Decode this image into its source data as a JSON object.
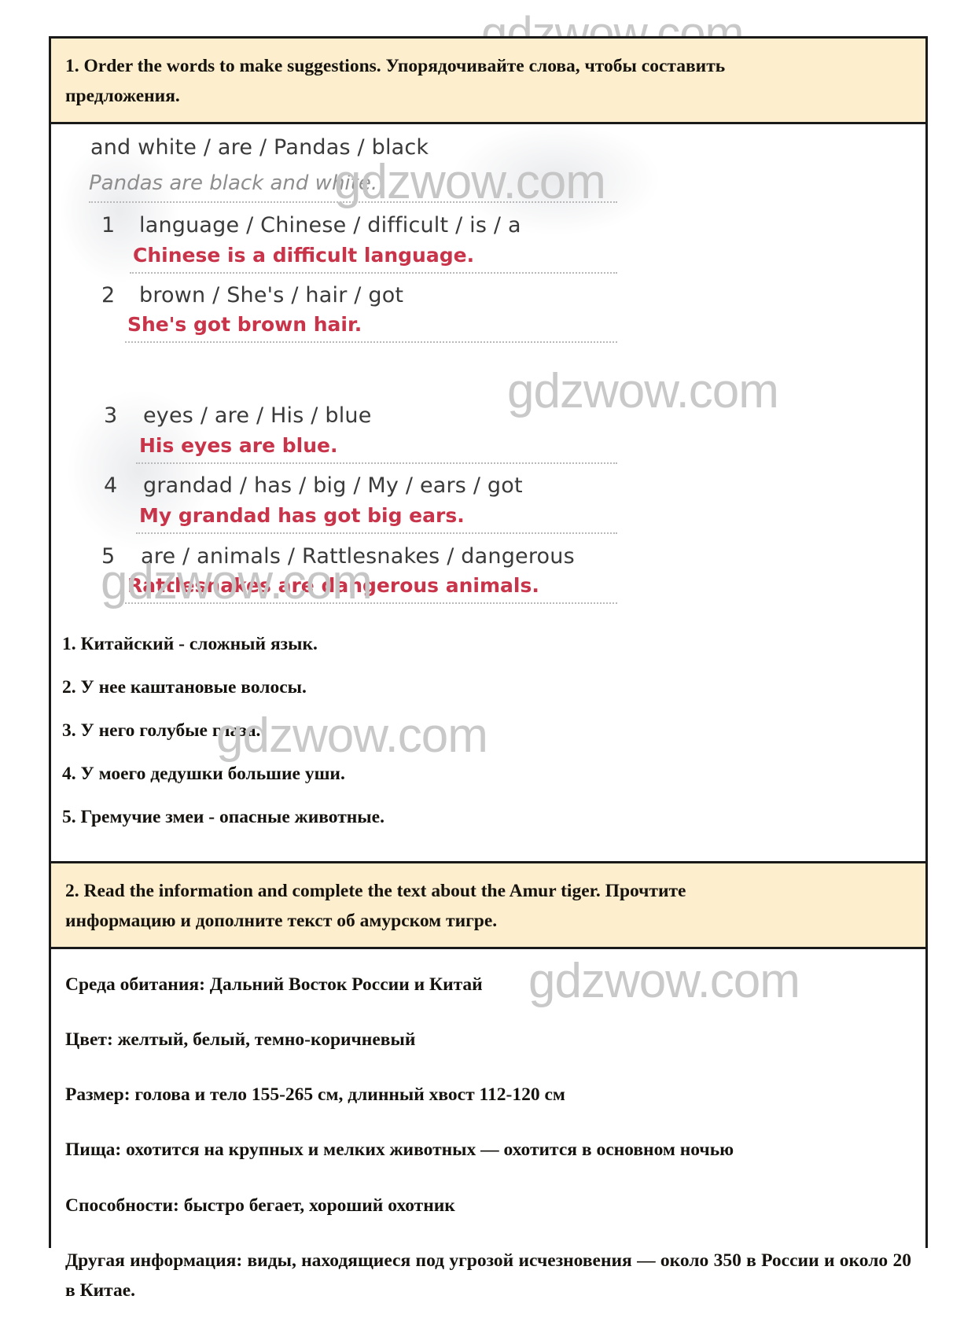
{
  "watermark": {
    "text": "gdzwow.com",
    "color": "#c9c9c9"
  },
  "colors": {
    "band_background": "#fdefce",
    "border": "#1a1a1a",
    "answer_red": "#c8354a",
    "page_background": "#ffffff"
  },
  "exercise1": {
    "heading": "1. Order the words to make suggestions. Упорядочивайте слова, чтобы составить",
    "heading_line2": "предложения.",
    "scan": {
      "example": {
        "prompt": "and white / are / Pandas / black",
        "answer": "Pandas are black and white."
      },
      "items": [
        {
          "number": "1",
          "prompt": "language / Chinese / difficult / is / a",
          "answer": "Chinese is a difficult language."
        },
        {
          "number": "2",
          "prompt": "brown / She's / hair / got",
          "answer": "She's got brown hair."
        },
        {
          "number": "3",
          "prompt": "eyes / are / His / blue",
          "answer": "His eyes are blue."
        },
        {
          "number": "4",
          "prompt": "grandad / has / big / My / ears / got",
          "answer": "My grandad has got big ears."
        },
        {
          "number": "5",
          "prompt": "are / animals / Rattlesnakes / dangerous",
          "answer": "Rattlesnakes are dangerous animals."
        }
      ]
    },
    "translations": [
      "1. Китайский - сложный язык.",
      "2. У нее каштановые волосы.",
      "3. У него голубые глаза.",
      "4. У моего дедушки большие уши.",
      "5. Гремучие змеи - опасные животные."
    ]
  },
  "exercise2": {
    "heading": "2. Read the information and complete the text about the Amur tiger. Прочтите",
    "heading_line2": "информацию и дополните текст об амурском тигре.",
    "facts": [
      "Среда обитания: Дальний Восток России и Китай",
      "Цвет: желтый, белый, темно-коричневый",
      "Размер: голова и тело 155-265 см, длинный хвост 112-120 см",
      "Пища: охотится на крупных и мелких животных — охотится в основном ночью",
      "Способности: быстро бегает, хороший охотник",
      "Другая информация: виды, находящиеся под угрозой исчезновения — около 350 в России и около 20 в Китае."
    ]
  }
}
